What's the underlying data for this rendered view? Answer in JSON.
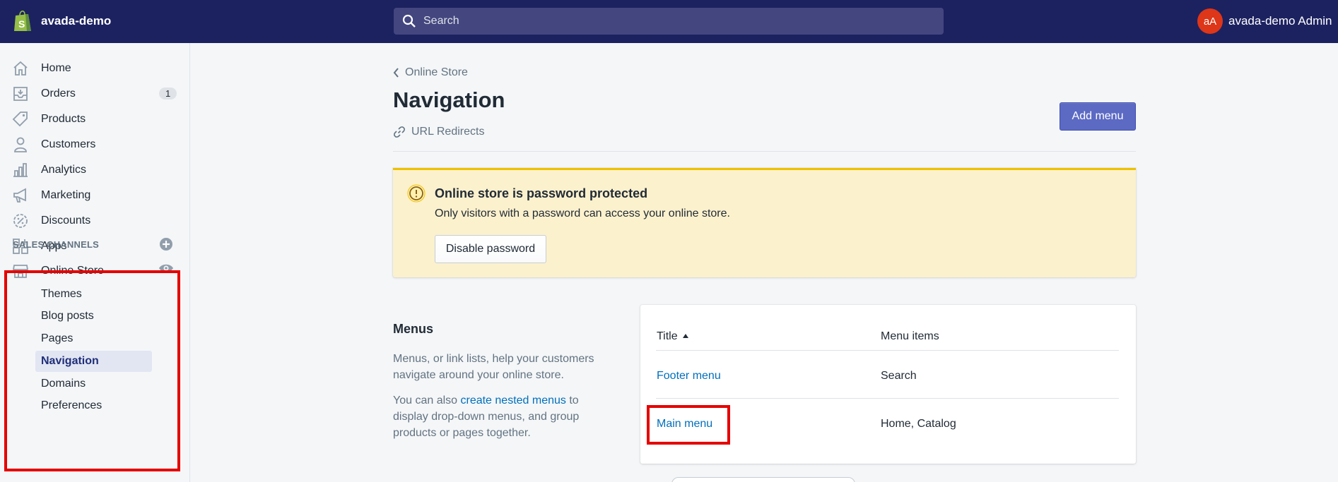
{
  "header": {
    "store_name": "avada-demo",
    "search_placeholder": "Search",
    "avatar_initials": "aA",
    "account_name": "avada-demo Admin"
  },
  "sidebar": {
    "items": [
      {
        "label": "Home",
        "icon": "home-icon"
      },
      {
        "label": "Orders",
        "icon": "orders-icon",
        "badge": "1"
      },
      {
        "label": "Products",
        "icon": "tag-icon"
      },
      {
        "label": "Customers",
        "icon": "person-icon"
      },
      {
        "label": "Analytics",
        "icon": "bar-chart-icon"
      },
      {
        "label": "Marketing",
        "icon": "megaphone-icon"
      },
      {
        "label": "Discounts",
        "icon": "discount-icon"
      },
      {
        "label": "Apps",
        "icon": "apps-icon"
      }
    ],
    "sales_channels_title": "SALES CHANNELS",
    "online_store_label": "Online Store",
    "sub_items": [
      "Themes",
      "Blog posts",
      "Pages",
      "Navigation",
      "Domains",
      "Preferences"
    ],
    "active_sub_item": "Navigation"
  },
  "main": {
    "back_label": "Online Store",
    "title": "Navigation",
    "url_redirects": "URL Redirects",
    "add_menu_label": "Add menu",
    "banner": {
      "title": "Online store is password protected",
      "text": "Only visitors with a password can access your online store.",
      "button": "Disable password"
    },
    "menus": {
      "heading": "Menus",
      "description": "Menus, or link lists, help your customers navigate around your online store.",
      "desc2_prefix": "You can also ",
      "desc2_link": "create nested menus",
      "desc2_suffix": " to display drop-down menus, and group products or pages together."
    },
    "table": {
      "columns": [
        "Title",
        "Menu items"
      ],
      "rows": [
        {
          "title": "Footer menu",
          "items": "Search"
        },
        {
          "title": "Main menu",
          "items": "Home, Catalog"
        }
      ]
    }
  },
  "colors": {
    "topbar": "#1c2260",
    "accent": "#5c6ac4",
    "link": "#006fbb",
    "warning_bg": "#fcf1cd",
    "highlight": "#e60000"
  }
}
